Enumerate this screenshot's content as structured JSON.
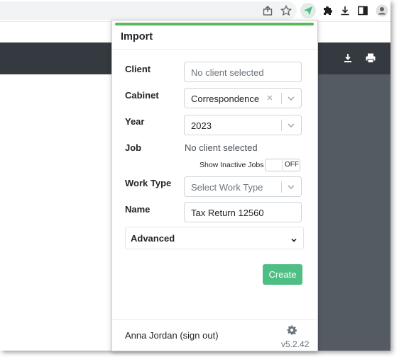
{
  "popup": {
    "title": "Import",
    "fields": {
      "client": {
        "label": "Client",
        "placeholder": "No client selected"
      },
      "cabinet": {
        "label": "Cabinet",
        "value": "Correspondence"
      },
      "year": {
        "label": "Year",
        "value": "2023"
      },
      "job": {
        "label": "Job",
        "value": "No client selected"
      },
      "show_inactive": {
        "label": "Show Inactive Jobs",
        "state": "OFF"
      },
      "work_type": {
        "label": "Work Type",
        "placeholder": "Select Work Type"
      },
      "name": {
        "label": "Name",
        "value": "Tax Return 12560"
      }
    },
    "advanced_label": "Advanced",
    "create_label": "Create",
    "footer": {
      "user": "Anna Jordan  (sign out)",
      "version": "v5.2.42"
    }
  },
  "colors": {
    "accent_green": "#4fbe85",
    "top_bar_green": "#5cb85c",
    "app_header": "#343a40",
    "app_panel": "#545b62"
  },
  "icons": {
    "toolbar": [
      "share-icon",
      "star-icon",
      "extension-send-icon",
      "puzzle-icon",
      "download-icon",
      "side-panel-icon",
      "profile-icon"
    ],
    "app_header": [
      "download-icon",
      "print-icon"
    ]
  }
}
